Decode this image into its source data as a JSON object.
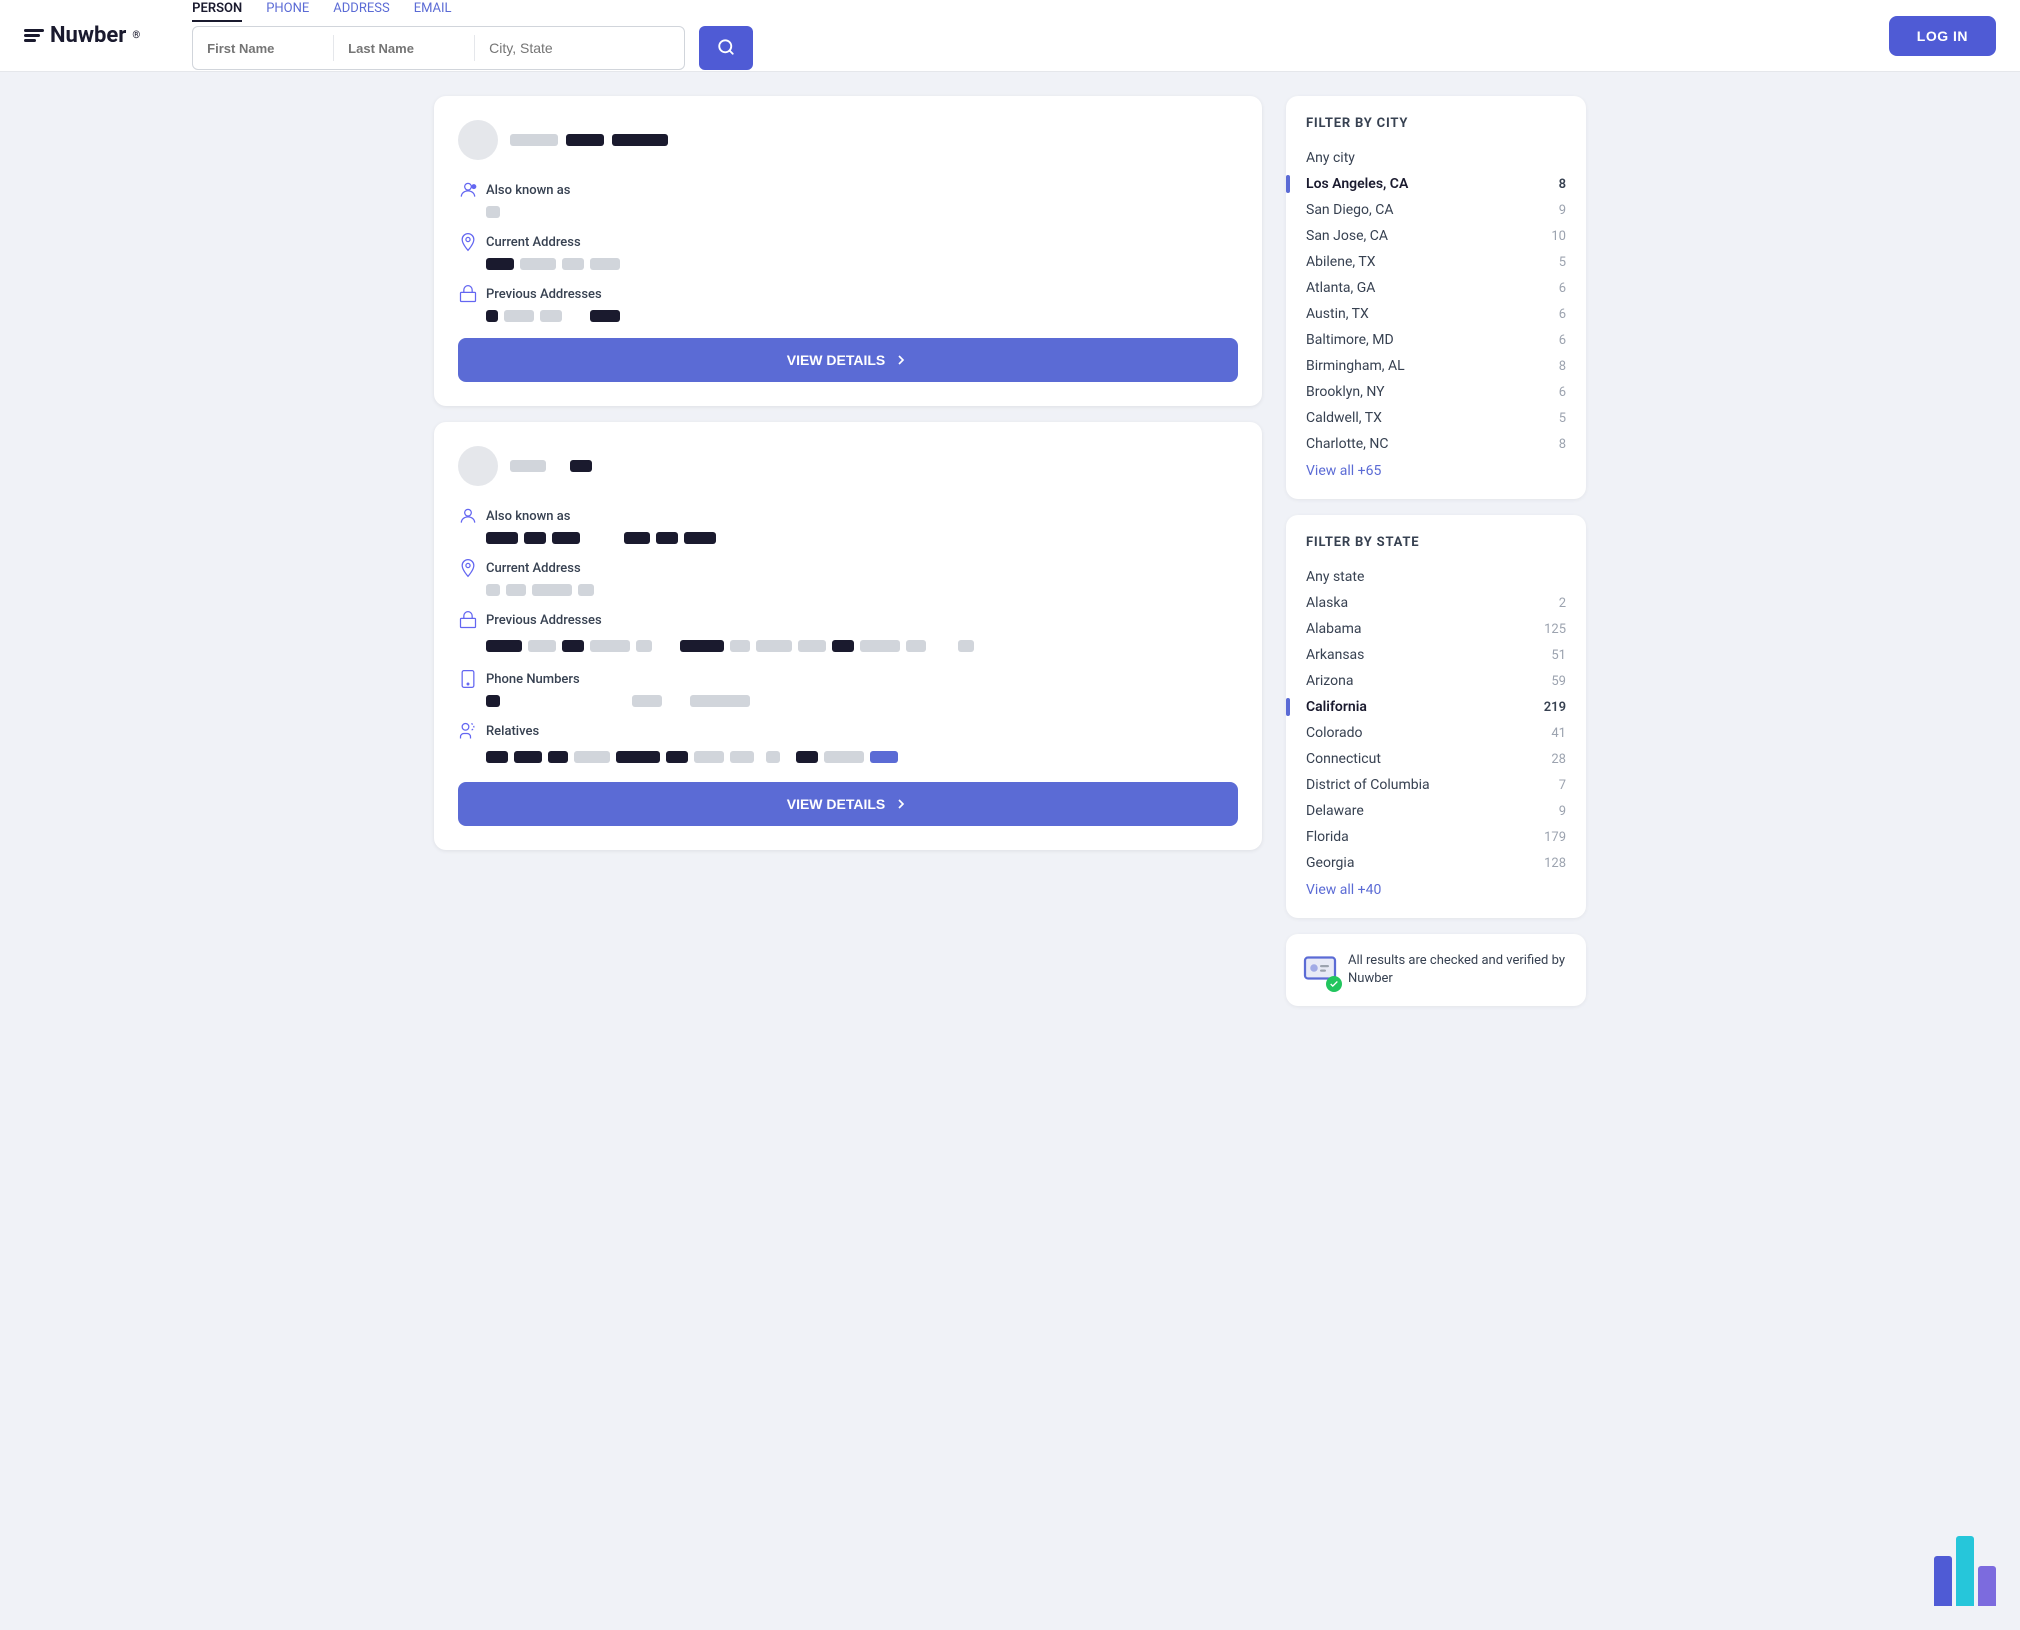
{
  "header": {
    "logo_text": "Nuwber",
    "tabs": [
      "PERSON",
      "PHONE",
      "ADDRESS",
      "EMAIL"
    ],
    "active_tab": "PERSON",
    "search_first_placeholder": "First Name",
    "search_last_placeholder": "Last Name",
    "search_city_placeholder": "City, State",
    "login_label": "LOG IN"
  },
  "filters": {
    "city_title": "FILTER BY CITY",
    "city_items": [
      {
        "label": "Any city",
        "count": ""
      },
      {
        "label": "Los Angeles, CA",
        "count": "8",
        "active": true
      },
      {
        "label": "San Diego, CA",
        "count": "9"
      },
      {
        "label": "San Jose, CA",
        "count": "10"
      },
      {
        "label": "Abilene, TX",
        "count": "5"
      },
      {
        "label": "Atlanta, GA",
        "count": "6"
      },
      {
        "label": "Austin, TX",
        "count": "6"
      },
      {
        "label": "Baltimore, MD",
        "count": "6"
      },
      {
        "label": "Birmingham, AL",
        "count": "8"
      },
      {
        "label": "Brooklyn, NY",
        "count": "6"
      },
      {
        "label": "Caldwell, TX",
        "count": "5"
      },
      {
        "label": "Charlotte, NC",
        "count": "8"
      }
    ],
    "city_view_all": "View all +65",
    "state_title": "FILTER BY STATE",
    "state_items": [
      {
        "label": "Any state",
        "count": ""
      },
      {
        "label": "Alaska",
        "count": "2"
      },
      {
        "label": "Alabama",
        "count": "125"
      },
      {
        "label": "Arkansas",
        "count": "51"
      },
      {
        "label": "Arizona",
        "count": "59"
      },
      {
        "label": "California",
        "count": "219",
        "active": true
      },
      {
        "label": "Colorado",
        "count": "41"
      },
      {
        "label": "Connecticut",
        "count": "28"
      },
      {
        "label": "District of Columbia",
        "count": "7"
      },
      {
        "label": "Delaware",
        "count": "9"
      },
      {
        "label": "Florida",
        "count": "179"
      },
      {
        "label": "Georgia",
        "count": "128"
      }
    ],
    "state_view_all": "View all +40"
  },
  "verified_text": "All results are checked and verified by Nuwber",
  "card1": {
    "also_known_as_label": "Also known as",
    "current_address_label": "Current Address",
    "previous_addresses_label": "Previous Addresses",
    "view_details_label": "VIEW DETAILS"
  },
  "card2": {
    "also_known_as_label": "Also known as",
    "current_address_label": "Current Address",
    "previous_addresses_label": "Previous Addresses",
    "phone_numbers_label": "Phone Numbers",
    "relatives_label": "Relatives",
    "view_details_label": "VIEW DETAILS"
  }
}
